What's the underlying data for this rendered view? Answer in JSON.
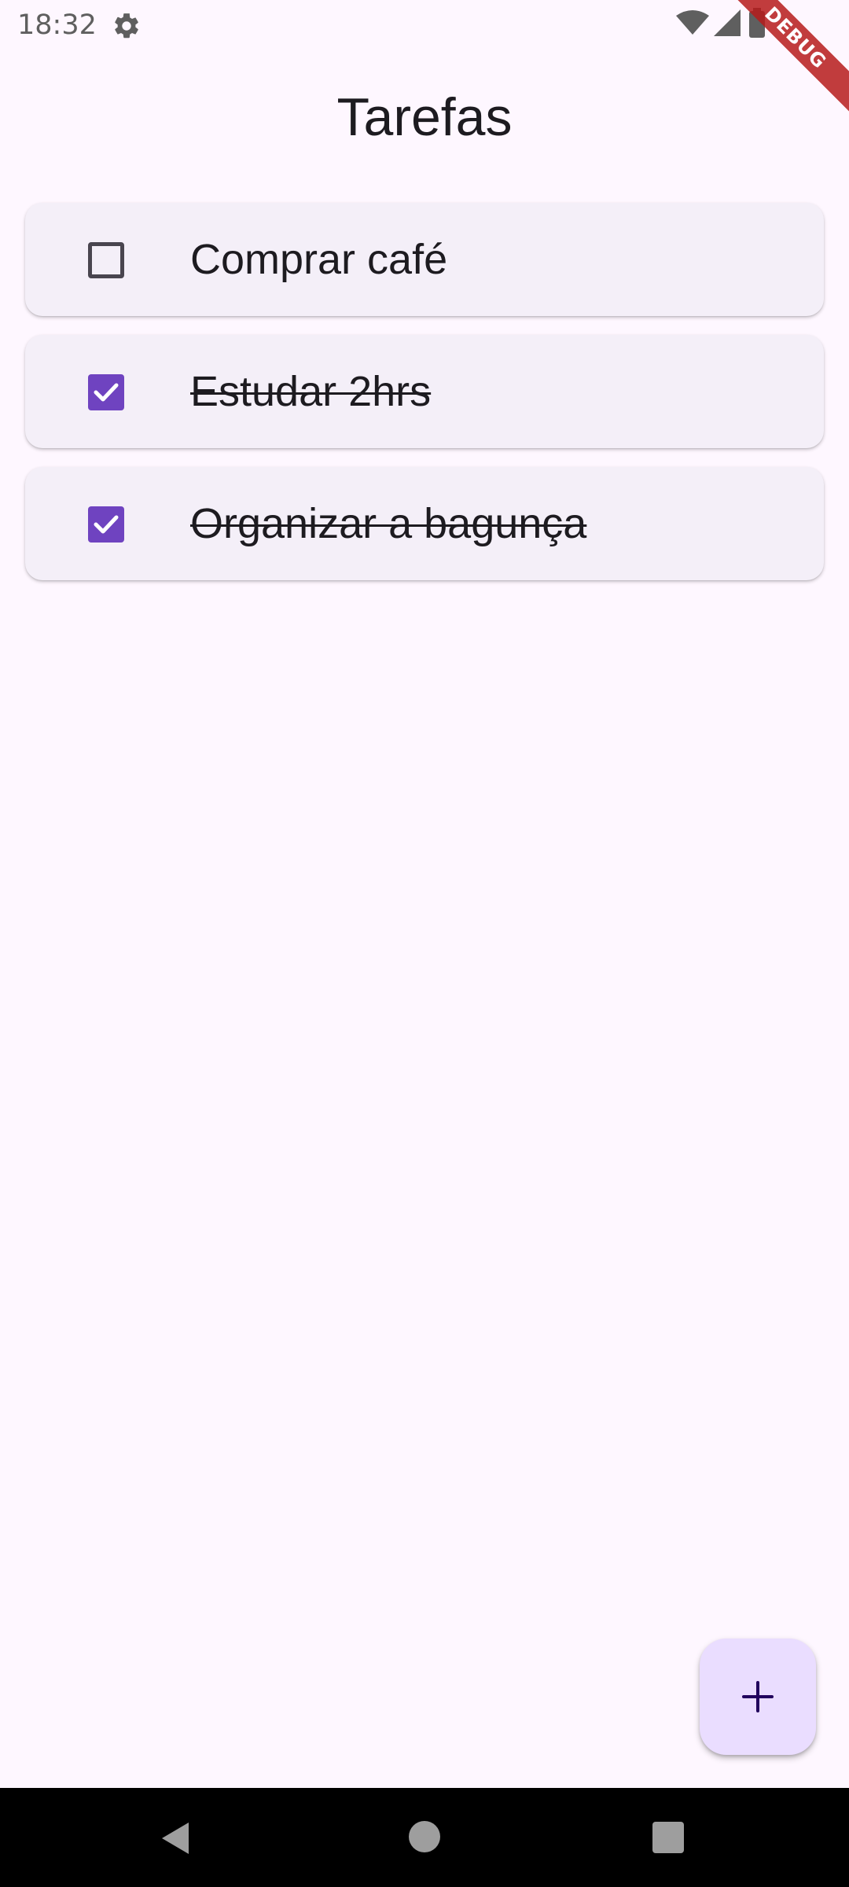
{
  "status_bar": {
    "time": "18:32",
    "icons": [
      "gear-icon",
      "wifi-icon",
      "signal-icon",
      "battery-icon"
    ]
  },
  "debug_banner": {
    "label": "DEBUG",
    "color": "#b71c1c"
  },
  "app_bar": {
    "title": "Tarefas"
  },
  "tasks": [
    {
      "label": "Comprar café",
      "done": false
    },
    {
      "label": "Estudar 2hrs",
      "done": true
    },
    {
      "label": "Organizar a bagunça",
      "done": true
    }
  ],
  "fab": {
    "icon": "plus-icon",
    "color": "#EADDFF"
  },
  "nav_bar": {
    "icons": [
      "back-icon",
      "home-icon",
      "recents-icon"
    ]
  },
  "colors": {
    "background": "#FEF7FF",
    "card": "#F4EFF8",
    "checkbox_checked": "#6F43C0",
    "text": "#1d1b20"
  }
}
